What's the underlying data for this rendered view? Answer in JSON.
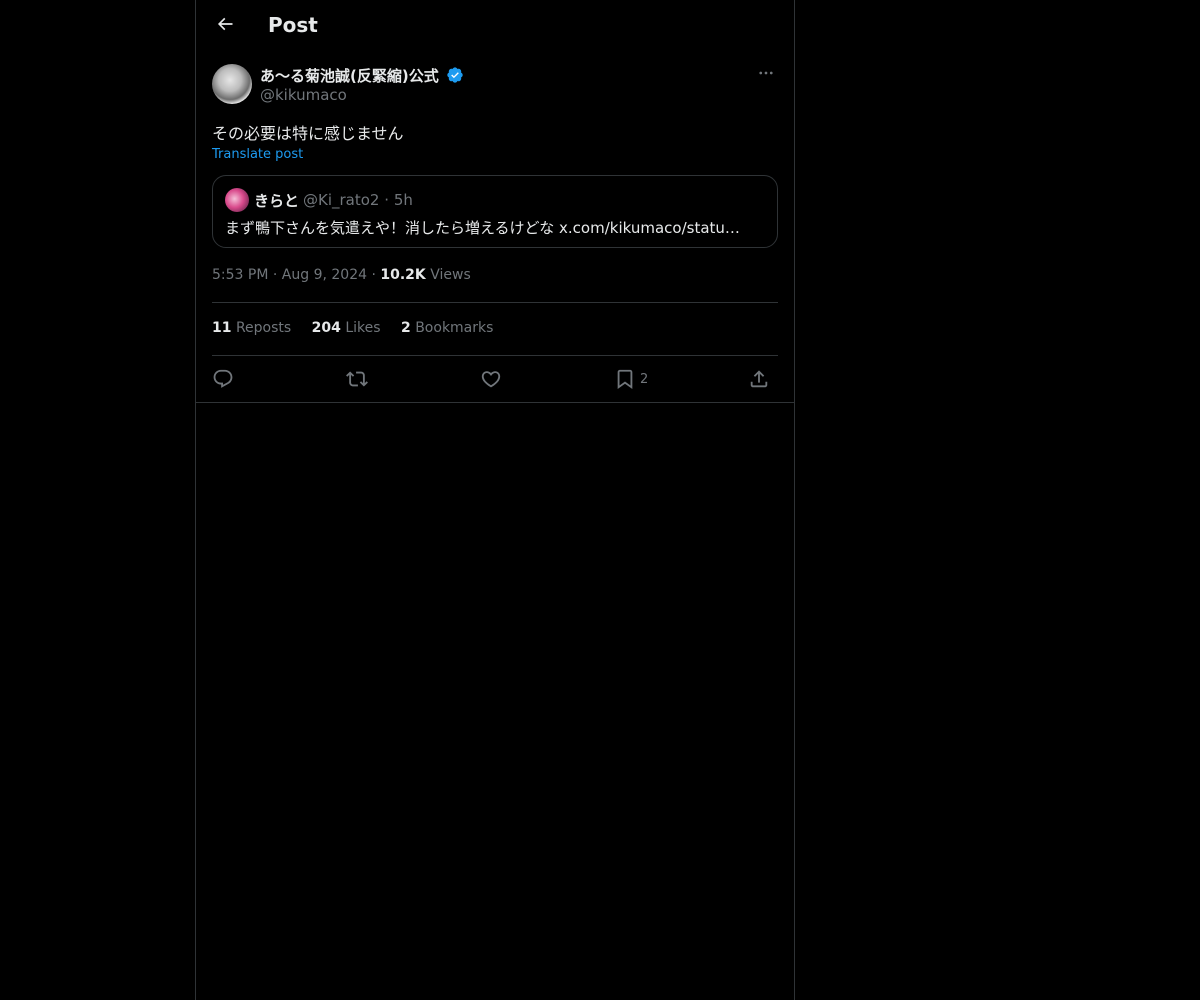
{
  "header": {
    "title": "Post"
  },
  "post": {
    "author": {
      "display_name": "あ〜る菊池誠(反緊縮)公式",
      "handle": "@kikumaco",
      "verified": true
    },
    "text": "その必要は特に感じません",
    "translate_label": "Translate post",
    "quote": {
      "display_name": "きらと",
      "handle": "@Ki_rato2",
      "separator": "·",
      "time": "5h",
      "text": "まず鴨下さんを気遣えや！消したら増えるけどな x.com/kikumaco/statu…"
    },
    "meta": {
      "time": "5:53 PM",
      "sep1": "·",
      "date": "Aug 9, 2024",
      "sep2": "·",
      "views_count": "10.2K",
      "views_label": "Views"
    },
    "stats": {
      "reposts_count": "11",
      "reposts_label": "Reposts",
      "likes_count": "204",
      "likes_label": "Likes",
      "bookmarks_count": "2",
      "bookmarks_label": "Bookmarks"
    },
    "actions": {
      "bookmark_count": "2"
    }
  },
  "icons": {
    "back": "arrow-left-icon",
    "more": "more-horizontal-icon",
    "verified": "verified-badge-icon",
    "reply": "reply-icon",
    "repost": "repost-icon",
    "like": "heart-icon",
    "bookmark": "bookmark-icon",
    "share": "share-icon"
  },
  "colors": {
    "background": "#000000",
    "text": "#e7e9ea",
    "muted": "#71767b",
    "accent": "#1d9bf0",
    "border": "#2f3336"
  }
}
